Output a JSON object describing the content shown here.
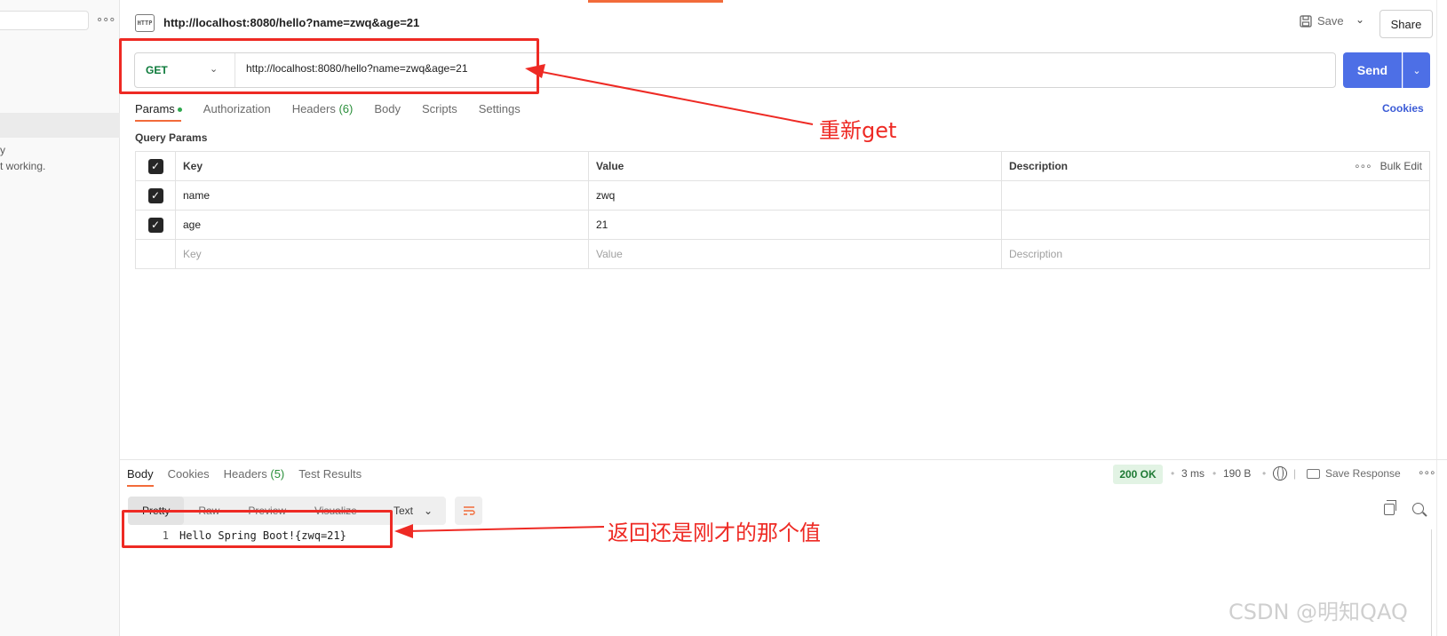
{
  "sidebar": {
    "dots": "∘∘∘",
    "snippet_lines": [
      "y",
      "t working."
    ]
  },
  "header": {
    "icon_label": "HTTP",
    "title": "http://localhost:8080/hello?name=zwq&age=21",
    "save_label": "Save",
    "share_label": "Share"
  },
  "request": {
    "method": "GET",
    "url": "http://localhost:8080/hello?name=zwq&age=21",
    "send_label": "Send"
  },
  "request_tabs": [
    {
      "label": "Params",
      "count": ""
    },
    {
      "label": "Authorization",
      "count": ""
    },
    {
      "label": "Headers",
      "count": "(6)"
    },
    {
      "label": "Body",
      "count": ""
    },
    {
      "label": "Scripts",
      "count": ""
    },
    {
      "label": "Settings",
      "count": ""
    }
  ],
  "cookies_label": "Cookies",
  "query_params": {
    "title": "Query Params",
    "headers": {
      "key": "Key",
      "value": "Value",
      "description": "Description",
      "bulk_edit": "Bulk Edit"
    },
    "rows": [
      {
        "key": "name",
        "value": "zwq",
        "description": ""
      },
      {
        "key": "age",
        "value": "21",
        "description": ""
      }
    ],
    "placeholder": {
      "key": "Key",
      "value": "Value",
      "description": "Description"
    }
  },
  "response": {
    "tabs": [
      {
        "label": "Body",
        "count": ""
      },
      {
        "label": "Cookies",
        "count": ""
      },
      {
        "label": "Headers",
        "count": "(5)"
      },
      {
        "label": "Test Results",
        "count": ""
      }
    ],
    "status": "200 OK",
    "time": "3 ms",
    "size": "190 B",
    "save_response_label": "Save Response",
    "view_modes": [
      "Pretty",
      "Raw",
      "Preview",
      "Visualize"
    ],
    "format": "Text",
    "lines": [
      {
        "number": "1",
        "text": "Hello Spring Boot!{zwq=21}"
      }
    ]
  },
  "annotations": {
    "regets": "重新get",
    "same_value": "返回还是刚才的那个值",
    "color": "#ee2a24"
  },
  "watermark": "CSDN @明知QAQ"
}
